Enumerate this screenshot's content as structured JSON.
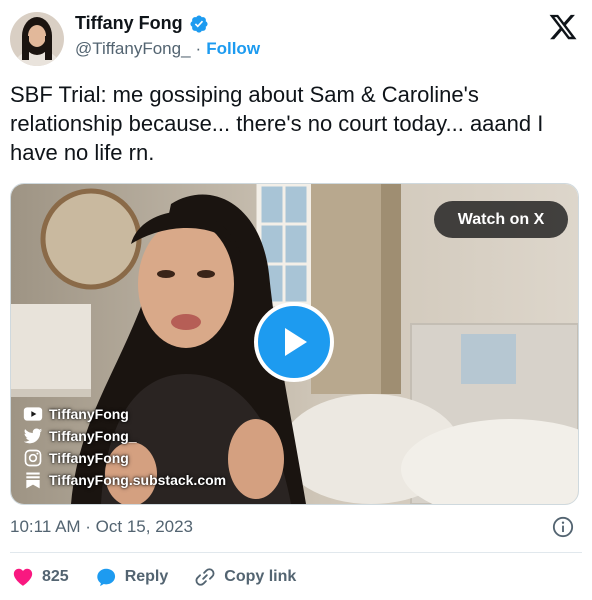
{
  "author": {
    "display_name": "Tiffany Fong",
    "handle": "@TiffanyFong_",
    "separator": "·",
    "follow_label": "Follow",
    "verified": true
  },
  "tweet": {
    "text": "SBF Trial: me gossiping about Sam & Caroline's relationship because... there's no court today... aaand I have no life rn."
  },
  "media": {
    "watch_label": "Watch on X",
    "socials": [
      {
        "icon": "youtube-icon",
        "label": "TiffanyFong"
      },
      {
        "icon": "twitter-bird-icon",
        "label": "TiffanyFong_"
      },
      {
        "icon": "instagram-icon",
        "label": "TiffanyFong"
      },
      {
        "icon": "substack-icon",
        "label": "TiffanyFong.substack.com"
      }
    ]
  },
  "timestamp": "10:11 AM · Oct 15, 2023",
  "actions": {
    "likes": "825",
    "reply_label": "Reply",
    "copy_label": "Copy link"
  },
  "colors": {
    "accent": "#1d9bf0",
    "like": "#f91880",
    "muted": "#536471"
  }
}
